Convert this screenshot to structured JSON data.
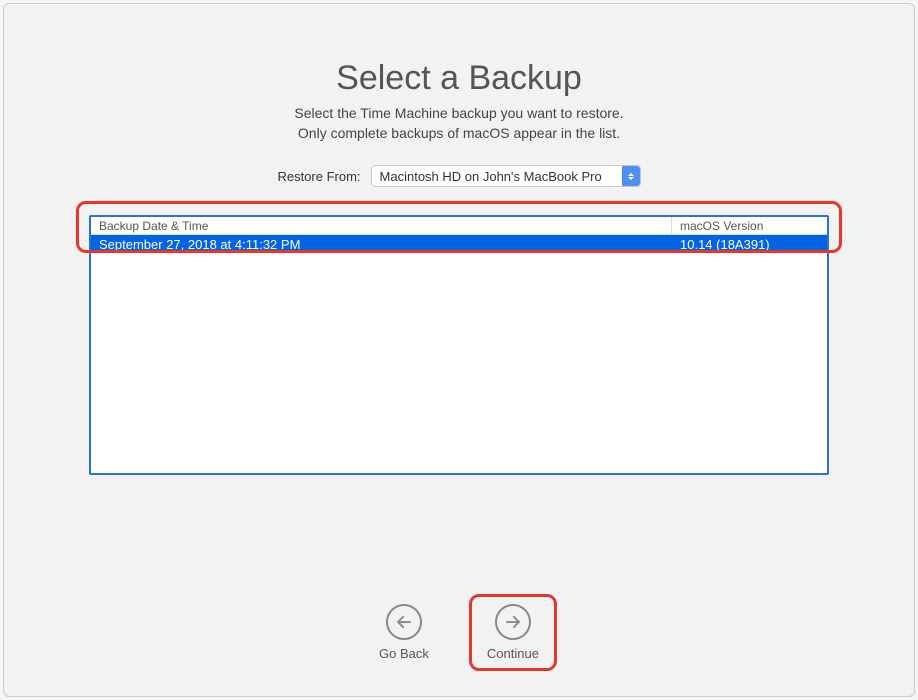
{
  "header": {
    "title": "Select a Backup",
    "subtitle_line1": "Select the Time Machine backup you want to restore.",
    "subtitle_line2": "Only complete backups of macOS appear in the list."
  },
  "restore": {
    "label": "Restore From:",
    "selected": "Macintosh HD on John's MacBook Pro"
  },
  "table": {
    "headers": {
      "date": "Backup Date & Time",
      "version": "macOS Version"
    },
    "rows": [
      {
        "date": "September 27, 2018 at 4:11:32 PM",
        "version": "10.14 (18A391)"
      }
    ]
  },
  "footer": {
    "back_label": "Go Back",
    "continue_label": "Continue"
  }
}
